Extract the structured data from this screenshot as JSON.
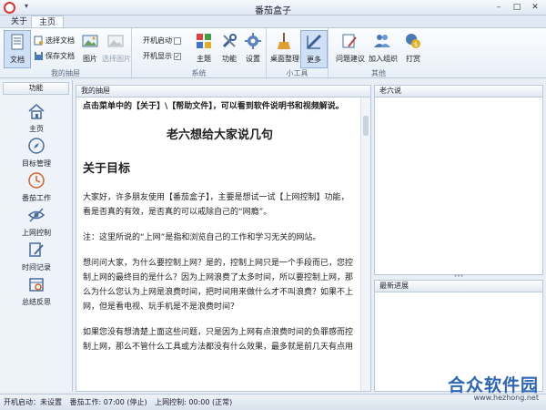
{
  "window": {
    "title": "番茄盒子",
    "quick_access": "▾"
  },
  "tabs": [
    {
      "label": "关于"
    },
    {
      "label": "主页"
    }
  ],
  "ribbon": {
    "group_mydesk": {
      "label": "我的抽屉",
      "doc": "文档",
      "select_doc": "选择文档",
      "save_doc": "保存文档",
      "image": "图片",
      "select_image": "选择图片"
    },
    "group_system": {
      "label": "系统",
      "boot_start": "开机启动",
      "boot_show": "开机显示",
      "theme": "主题",
      "function": "功能",
      "settings": "设置"
    },
    "group_tools": {
      "label": "小工具",
      "desktop_clean": "桌面整理",
      "more": "更多"
    },
    "group_other": {
      "label": "其他",
      "suggestion": "问题建议",
      "join_group": "加入组织",
      "donate": "打赏"
    }
  },
  "sidebar": {
    "header": "功能",
    "items": [
      {
        "label": "主页",
        "icon": "home-icon"
      },
      {
        "label": "目标管理",
        "icon": "compass-icon"
      },
      {
        "label": "番茄工作",
        "icon": "clock-icon"
      },
      {
        "label": "上网控制",
        "icon": "eye-off-icon"
      },
      {
        "label": "时间记录",
        "icon": "pen-paper-icon"
      },
      {
        "label": "总结反思",
        "icon": "calendar-icon"
      }
    ]
  },
  "main": {
    "header": "我的抽屉",
    "doc": {
      "note": "点击菜单中的【关于】\\【帮助文件】，可以看到软件说明书和视频解说。",
      "title": "老六想给大家说几句",
      "section": "关于目标",
      "p1": "大家好，许多朋友使用【番茄盒子】，主要是想试一试【上网控制】功能，看是否真的有效，是否真的可以戒除自己的“网瘾”。",
      "p2": "注：这里所说的“上网”是指和浏览自己的工作和学习无关的网站。",
      "p3": "想问问大家，为什么要控制上网？是的，控制上网只是一个手段而已，您控制上网的最终目的是什么？因为上网浪费了太多时间，所以要控制上网，那么为什么您认为上网是浪费时间，把时间用来做什么才不叫浪费？如果不上网，但是看电视、玩手机是不是浪费时间？",
      "p4": "如果您没有想清楚上面这些问题，只是因为上网有点浪费时间的负罪感而控制上网，那么不管什么工具或方法都没有什么效果，最多就是前几天有点用"
    }
  },
  "right_panel_top": {
    "header": "老六说"
  },
  "right_panel_bottom": {
    "header": "最新进展"
  },
  "status": {
    "boot": "开机启动：未设置",
    "tomato": "番茄工作: 07:00 (停止)",
    "net": "上网控制: 00:00 (正常)"
  },
  "watermark": {
    "big": "合众软件园",
    "small": "www.hezhong.net"
  }
}
